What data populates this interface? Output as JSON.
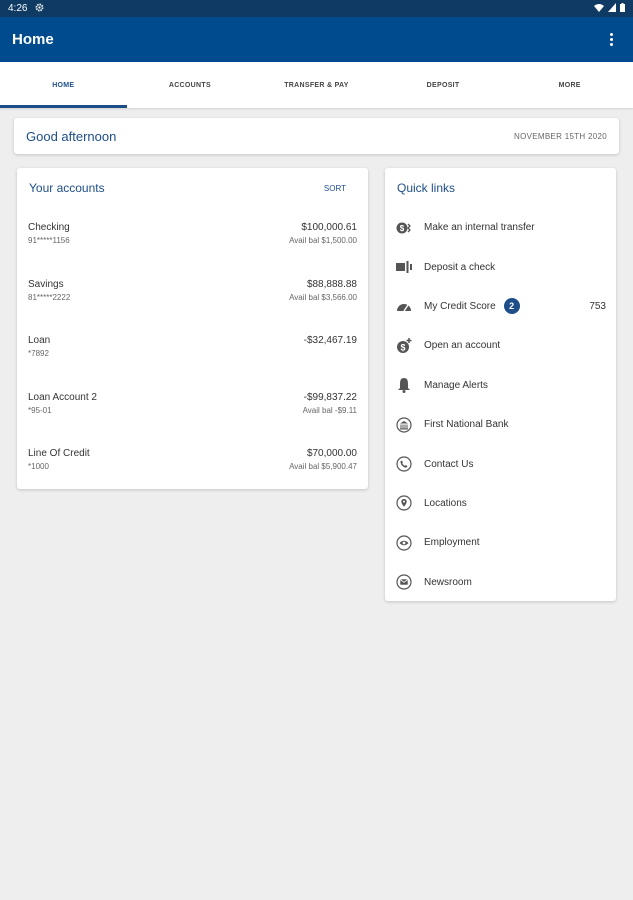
{
  "status": {
    "time": "4:26"
  },
  "app_bar": {
    "title": "Home"
  },
  "tabs": [
    {
      "label": "HOME"
    },
    {
      "label": "ACCOUNTS"
    },
    {
      "label": "TRANSFER & PAY"
    },
    {
      "label": "DEPOSIT"
    },
    {
      "label": "MORE"
    }
  ],
  "greeting": {
    "text": "Good afternoon",
    "date": "NOVEMBER 15TH 2020"
  },
  "accounts": {
    "title": "Your accounts",
    "sort_label": "SORT",
    "items": [
      {
        "name": "Checking",
        "number": "91*****1156",
        "balance": "$100,000.61",
        "available": "Avail bal $1,500.00"
      },
      {
        "name": "Savings",
        "number": "81*****2222",
        "balance": "$88,888.88",
        "available": "Avail bal $3,566.00"
      },
      {
        "name": "Loan",
        "number": "*7892",
        "balance": "-$32,467.19",
        "available": ""
      },
      {
        "name": "Loan Account 2",
        "number": "*95-01",
        "balance": "-$99,837.22",
        "available": "Avail bal -$9.11"
      },
      {
        "name": "Line Of Credit",
        "number": "*1000",
        "balance": "$70,000.00",
        "available": "Avail bal $5,900.47"
      }
    ]
  },
  "quick_links": {
    "title": "Quick links",
    "items": [
      {
        "label": "Make an internal transfer",
        "icon": "transfer-icon"
      },
      {
        "label": "Deposit a check",
        "icon": "check-deposit-icon"
      },
      {
        "label": "My Credit Score",
        "icon": "gauge-icon",
        "badge": "2",
        "value": "753"
      },
      {
        "label": "Open an account",
        "icon": "open-account-icon"
      },
      {
        "label": "Manage Alerts",
        "icon": "bell-icon"
      },
      {
        "label": "First National Bank",
        "icon": "bank-icon"
      },
      {
        "label": "Contact Us",
        "icon": "phone-icon"
      },
      {
        "label": "Locations",
        "icon": "location-pin-icon"
      },
      {
        "label": "Employment",
        "icon": "eye-icon"
      },
      {
        "label": "Newsroom",
        "icon": "mail-icon"
      }
    ]
  },
  "colors": {
    "app_bar": "#004b8d",
    "status_bar": "#0f3a63",
    "accent": "#1d4e89",
    "background": "#eeeeee"
  }
}
